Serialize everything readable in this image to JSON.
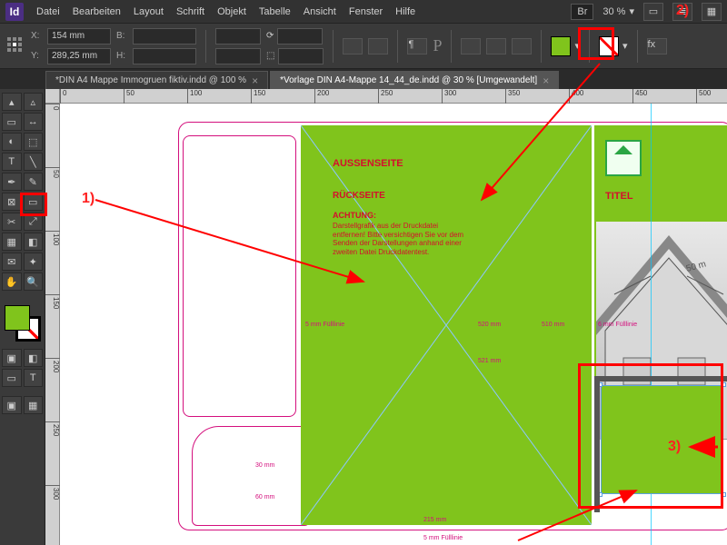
{
  "menubar": {
    "items": [
      "Datei",
      "Bearbeiten",
      "Layout",
      "Schrift",
      "Objekt",
      "Tabelle",
      "Ansicht",
      "Fenster",
      "Hilfe"
    ],
    "bridge": "Br",
    "zoom": "30 %"
  },
  "ctrl": {
    "x_label": "X:",
    "x_value": "154 mm",
    "y_label": "Y:",
    "y_value": "289,25 mm",
    "w_label": "B:",
    "h_label": "H:"
  },
  "tabs": [
    {
      "label": "*DIN A4 Mappe Immogruen fiktiv.indd @ 100 %",
      "active": false
    },
    {
      "label": "*Vorlage DIN A4-Mappe 14_44_de.indd @ 30 % [Umgewandelt]",
      "active": true
    }
  ],
  "ruler_h": [
    "0",
    "50",
    "100",
    "150",
    "200",
    "250",
    "300",
    "350",
    "400",
    "450",
    "500"
  ],
  "ruler_v": [
    "0",
    "50",
    "100",
    "150",
    "200",
    "250",
    "300"
  ],
  "doc": {
    "heading": "AUSSENSEITE",
    "sub": "RÜCKSEITE",
    "warn_title": "ACHTUNG:",
    "warn_body": "Darstellgrafik aus der Druckdatei entfernen! Bitte versichtigen Sie vor dem Senden der Darstellungen anhand einer zweiten Datei Druckdatentest.",
    "titel": "TITEL",
    "m1": "5 mm Fülllinie",
    "m2": "520 mm",
    "m3": "510 mm",
    "m4": "6 mm Fülllinie",
    "m5": "521 mm",
    "m6": "215 mm",
    "m7": "60 mm",
    "m8": "30 mm",
    "m9": "5 mm Fülllinie"
  },
  "annotations": {
    "a1": "1)",
    "a2": "2)",
    "a3": "3)"
  }
}
